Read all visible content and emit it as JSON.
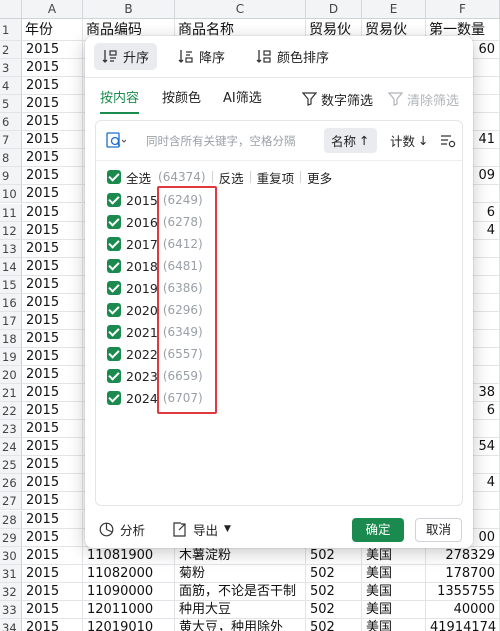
{
  "sheet": {
    "column_letters": [
      "A",
      "B",
      "C",
      "D",
      "E",
      "F"
    ],
    "headers": [
      "年份",
      "商品编码",
      "商品名称",
      "贸易伙",
      "贸易伙",
      "第一数量"
    ],
    "row_numbers": [
      "1",
      "2",
      "3",
      "4",
      "5",
      "6",
      "7",
      "8",
      "9",
      "10",
      "11",
      "12",
      "13",
      "14",
      "15",
      "16",
      "17",
      "18",
      "19",
      "20",
      "21",
      "22",
      "23",
      "24",
      "25",
      "26",
      "27",
      "28",
      "29",
      "30",
      "31",
      "32",
      "33",
      "34"
    ],
    "year_value": "2015",
    "visible_f_fragments": [
      {
        "row": "2",
        "text": "60"
      },
      {
        "row": "7",
        "text": "41"
      },
      {
        "row": "9",
        "text": "09"
      },
      {
        "row": "11",
        "text": "6"
      },
      {
        "row": "12",
        "text": "4"
      },
      {
        "row": "21",
        "text": "38"
      },
      {
        "row": "22",
        "text": "6"
      },
      {
        "row": "24",
        "text": "54"
      },
      {
        "row": "26",
        "text": "4"
      },
      {
        "row": "29",
        "text": "00"
      }
    ],
    "bottom_rows": [
      {
        "row": "30",
        "code": "11081900",
        "name": "木薯淀粉",
        "d": "502",
        "e": "美国",
        "f": "278329"
      },
      {
        "row": "31",
        "code": "11082000",
        "name": "菊粉",
        "d": "502",
        "e": "美国",
        "f": "178700"
      },
      {
        "row": "32",
        "code": "11090000",
        "name": "面筋，不论是否干制",
        "d": "502",
        "e": "美国",
        "f": "1355755"
      },
      {
        "row": "33",
        "code": "12011000",
        "name": "种用大豆",
        "d": "502",
        "e": "美国",
        "f": "40000"
      },
      {
        "row": "34",
        "code": "12019010",
        "name": "黄大豆，种用除外",
        "d": "502",
        "e": "美国",
        "f": "41914174"
      }
    ]
  },
  "panel": {
    "sort_asc": "升序",
    "sort_desc": "降序",
    "sort_color": "颜色排序",
    "tabs": [
      "按内容",
      "按颜色",
      "AI筛选"
    ],
    "number_filter": "数字筛选",
    "clear_filter": "清除筛选",
    "search_placeholder": "同时含所有关键字，空格分隔",
    "sort_by_name": "名称",
    "sort_by_count": "计数",
    "select_all": "全选",
    "select_all_count": "(64374)",
    "invert": "反选",
    "duplicates": "重复项",
    "more": "更多",
    "items": [
      {
        "label": "2015",
        "count": "(6249)"
      },
      {
        "label": "2016",
        "count": "(6278)"
      },
      {
        "label": "2017",
        "count": "(6412)"
      },
      {
        "label": "2018",
        "count": "(6481)"
      },
      {
        "label": "2019",
        "count": "(6386)"
      },
      {
        "label": "2020",
        "count": "(6296)"
      },
      {
        "label": "2021",
        "count": "(6349)"
      },
      {
        "label": "2022",
        "count": "(6557)"
      },
      {
        "label": "2023",
        "count": "(6659)"
      },
      {
        "label": "2024",
        "count": "(6707)"
      }
    ],
    "analyze": "分析",
    "export": "导出",
    "ok": "确定",
    "cancel": "取消"
  },
  "colors": {
    "accent": "#1a8a4e",
    "highlight_border": "#e0383e"
  }
}
